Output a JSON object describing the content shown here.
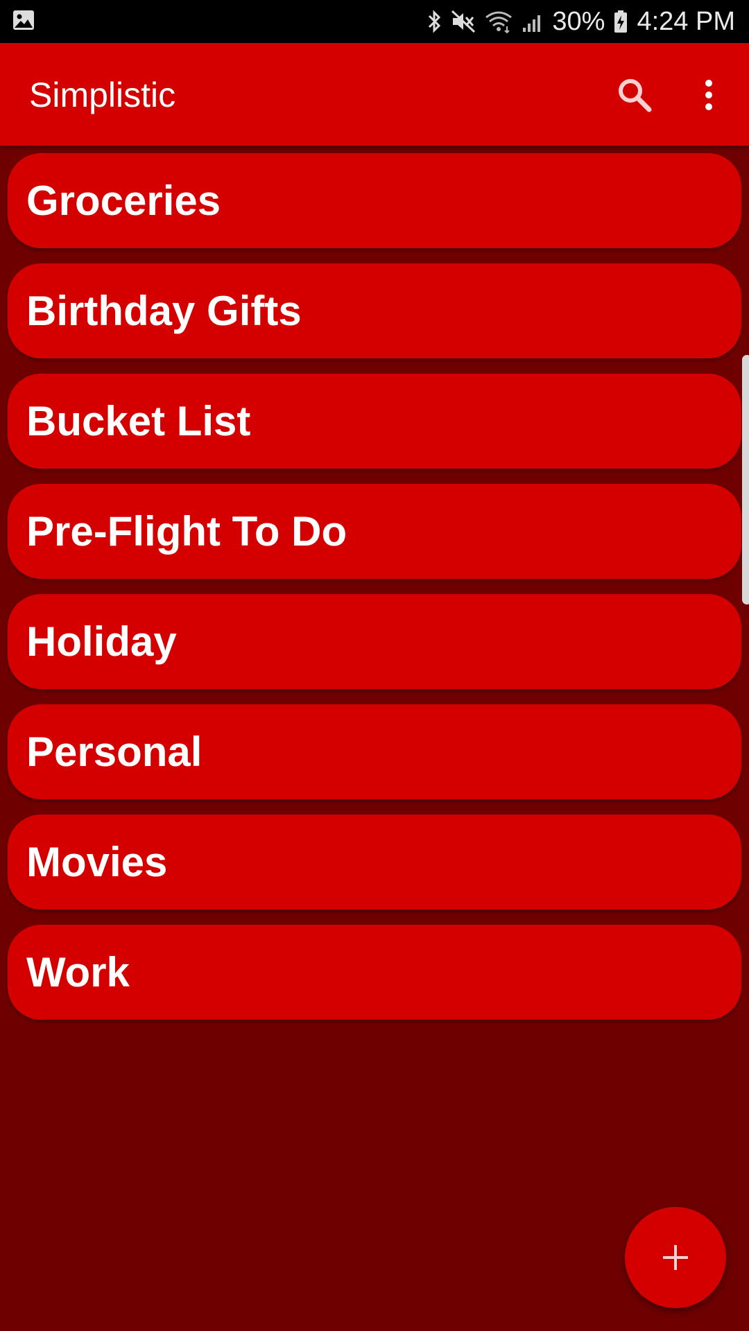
{
  "status_bar": {
    "battery_percent": "30%",
    "time": "4:24 PM",
    "icons": [
      "gallery-notification-icon",
      "bluetooth-icon",
      "mute-icon",
      "wifi-icon",
      "signal-icon",
      "battery-charging-icon"
    ]
  },
  "app_bar": {
    "title": "Simplistic",
    "actions": [
      "search-icon",
      "more-vert-icon"
    ]
  },
  "lists": [
    {
      "label": "Groceries"
    },
    {
      "label": "Birthday Gifts"
    },
    {
      "label": "Bucket List"
    },
    {
      "label": "Pre-Flight To Do"
    },
    {
      "label": "Holiday"
    },
    {
      "label": "Personal"
    },
    {
      "label": "Movies"
    },
    {
      "label": "Work"
    }
  ],
  "fab": {
    "icon": "plus-icon"
  },
  "colors": {
    "primary": "#d40000",
    "background": "#6e0000",
    "status_bar": "#000000",
    "text": "#ffffff"
  }
}
